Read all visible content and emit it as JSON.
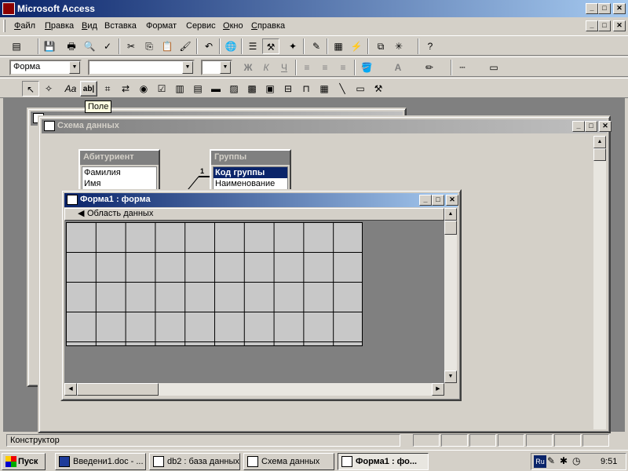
{
  "app": {
    "title": "Microsoft Access"
  },
  "menu": [
    {
      "label": "Файл",
      "u": "Ф",
      "rest": "айл"
    },
    {
      "label": "Правка",
      "u": "П",
      "rest": "равка"
    },
    {
      "label": "Вид",
      "u": "В",
      "rest": "ид"
    },
    {
      "label": "Вставка",
      "u": "",
      "rest": "Вставка"
    },
    {
      "label": "Формат",
      "u": "",
      "rest": "Формат"
    },
    {
      "label": "Сервис",
      "u": "",
      "rest": "Сервис"
    },
    {
      "label": "Окно",
      "u": "О",
      "rest": "кно"
    },
    {
      "label": "Справка",
      "u": "С",
      "rest": "правка"
    }
  ],
  "toolbar_format": {
    "object_combo": "Форма",
    "bold": "Ж",
    "italic": "К",
    "underline": "Ч"
  },
  "toolbox": {
    "tooltip": "Поле",
    "label_tool": "Aa",
    "textbox_tool": "ab|"
  },
  "schema_window": {
    "title": "Схема данных",
    "table1": {
      "name": "Абитуриент",
      "fields": [
        "Фамилия",
        "Имя"
      ]
    },
    "table2": {
      "name": "Группы",
      "fields": [
        "Код группы",
        "Наименование"
      ]
    },
    "relation_label": "1"
  },
  "form_window": {
    "title": "Форма1 : форма",
    "section": "Область данных"
  },
  "status": {
    "text": "Конструктор"
  },
  "taskbar": {
    "start": "Пуск",
    "tasks": [
      "Введени1.doc - ...",
      "db2 : база данных",
      "Схема данных",
      "Форма1 : фо..."
    ],
    "lang": "Ru",
    "clock": "9:51"
  }
}
